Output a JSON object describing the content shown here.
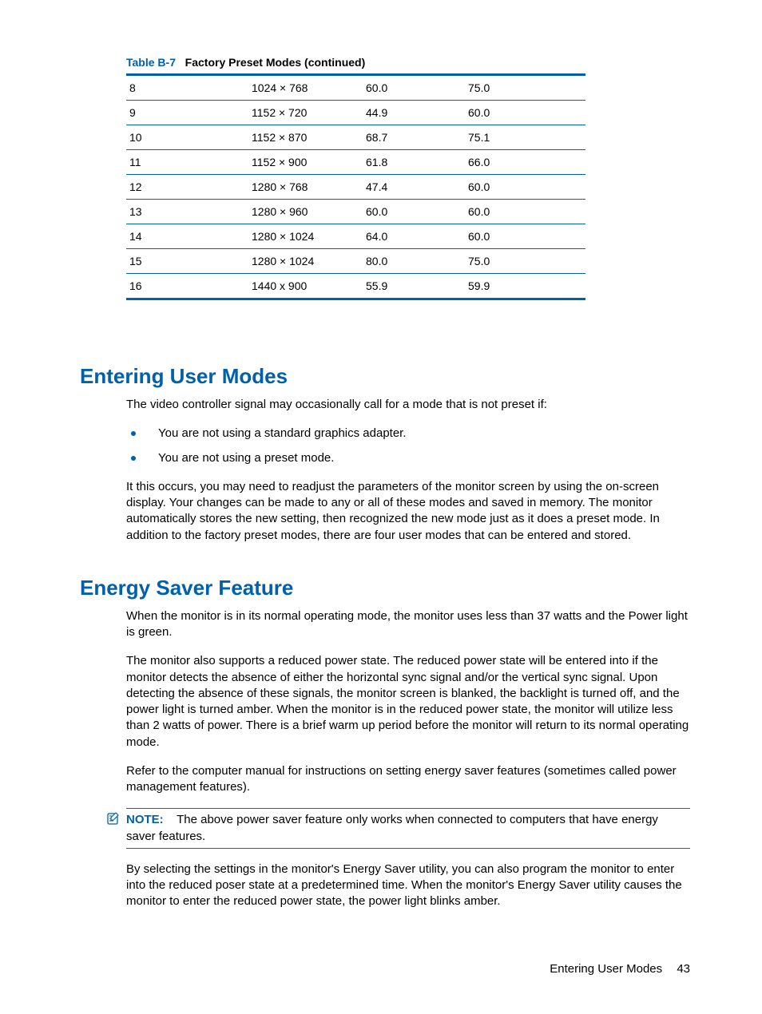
{
  "table": {
    "label": "Table B-7",
    "desc": "Factory Preset Modes (continued)",
    "rows": [
      {
        "n": "8",
        "res": "1024 × 768",
        "h": "60.0",
        "v": "75.0"
      },
      {
        "n": "9",
        "res": "1152 × 720",
        "h": "44.9",
        "v": "60.0"
      },
      {
        "n": "10",
        "res": "1152 × 870",
        "h": "68.7",
        "v": "75.1"
      },
      {
        "n": "11",
        "res": "1152 × 900",
        "h": "61.8",
        "v": "66.0"
      },
      {
        "n": "12",
        "res": "1280 × 768",
        "h": "47.4",
        "v": "60.0"
      },
      {
        "n": "13",
        "res": "1280 × 960",
        "h": "60.0",
        "v": "60.0"
      },
      {
        "n": "14",
        "res": "1280 × 1024",
        "h": "64.0",
        "v": "60.0"
      },
      {
        "n": "15",
        "res": "1280 × 1024",
        "h": "80.0",
        "v": "75.0"
      },
      {
        "n": "16",
        "res": "1440 x 900",
        "h": "55.9",
        "v": "59.9"
      }
    ]
  },
  "sections": {
    "user_modes": {
      "title": "Entering User Modes",
      "intro": "The video controller signal may occasionally call for a mode that is not preset if:",
      "bullets": [
        "You are not using a standard graphics adapter.",
        "You are not using a preset mode."
      ],
      "para": "It this occurs, you may need to readjust the parameters of the monitor screen by using the on-screen display. Your changes can be made to any or all of these modes and saved in memory. The monitor automatically stores the new setting, then recognized the new mode just as it does a preset mode. In addition to the factory preset modes, there are four user modes that can be entered and stored."
    },
    "energy_saver": {
      "title": "Energy Saver Feature",
      "p1": "When the monitor is in its normal operating mode, the monitor uses less than 37 watts and the Power light is green.",
      "p2": "The monitor also supports a reduced power state. The reduced power state will be entered into if the monitor detects the absence of either the horizontal sync signal and/or the vertical sync signal. Upon detecting the absence of these signals, the monitor screen is blanked, the backlight is turned off, and the power light is turned amber. When the monitor is in the reduced power state, the monitor will utilize less than 2 watts of power. There is a brief warm up period before the monitor will return to its normal operating mode.",
      "p3": "Refer to the computer manual for instructions on setting energy saver features (sometimes called power management features).",
      "note_label": "NOTE:",
      "note_text": "The above power saver feature only works when connected to computers that have energy saver features.",
      "p4": "By selecting the settings in the monitor's Energy Saver utility, you can also program the monitor to enter into the reduced poser state at a predetermined time. When the monitor's Energy Saver utility causes the monitor to enter the reduced power state, the power light blinks amber."
    }
  },
  "footer": {
    "text": "Entering User Modes",
    "page": "43"
  }
}
